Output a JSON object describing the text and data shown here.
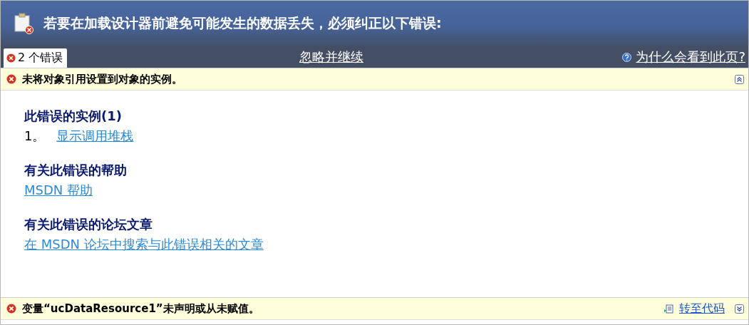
{
  "header": {
    "title": "若要在加载设计器前避免可能发生的数据丢失，必须纠正以下错误:"
  },
  "tabs": [
    {
      "label": "2 个错误",
      "selected": true
    }
  ],
  "ignore_link": "忽略并继续",
  "help_link": "为什么会看到此页?",
  "errors": [
    {
      "message": "未将对象引用设置到对象的实例。",
      "expanded": true,
      "sections": [
        {
          "heading": "此错误的实例(1)",
          "items": [
            {
              "number": "1。",
              "link": "显示调用堆栈"
            }
          ]
        },
        {
          "heading": "有关此错误的帮助",
          "items": [
            {
              "link": "MSDN 帮助"
            }
          ]
        },
        {
          "heading": "有关此错误的论坛文章",
          "items": [
            {
              "link": "在 MSDN 论坛中搜索与此错误相关的文章"
            }
          ]
        }
      ]
    },
    {
      "message": "变量“ucDataResource1”未声明或从未赋值。",
      "expanded": false,
      "goto_link": "转至代码"
    }
  ]
}
